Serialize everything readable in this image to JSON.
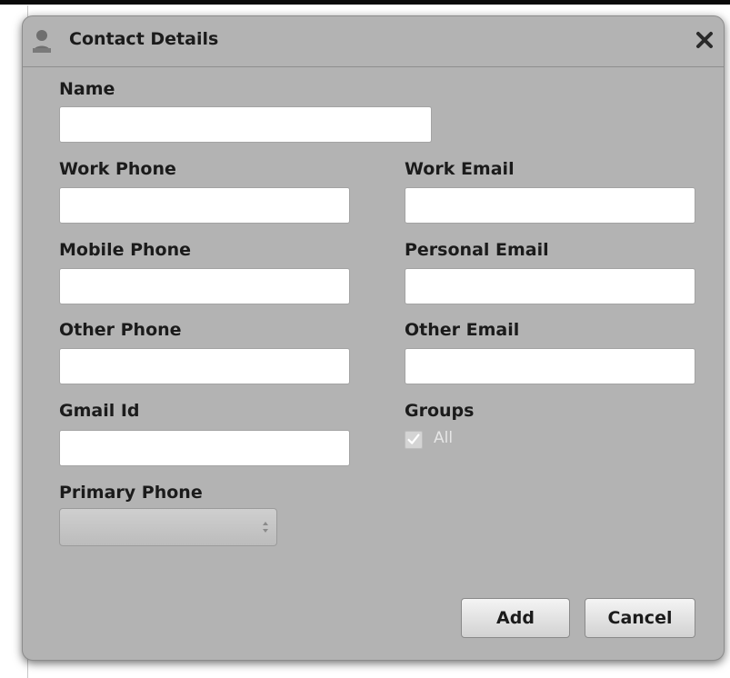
{
  "dialog": {
    "title": "Contact Details",
    "icons": {
      "title_icon": "user-icon",
      "close_icon": "close-icon"
    }
  },
  "form": {
    "name": {
      "label": "Name",
      "value": ""
    },
    "work_phone": {
      "label": "Work Phone",
      "value": ""
    },
    "work_email": {
      "label": "Work Email",
      "value": ""
    },
    "mobile_phone": {
      "label": "Mobile Phone",
      "value": ""
    },
    "personal_email": {
      "label": "Personal Email",
      "value": ""
    },
    "other_phone": {
      "label": "Other Phone",
      "value": ""
    },
    "other_email": {
      "label": "Other Email",
      "value": ""
    },
    "gmail_id": {
      "label": "Gmail Id",
      "value": ""
    },
    "groups": {
      "label": "Groups",
      "checkbox_label": "All",
      "checked": true,
      "disabled": true
    },
    "primary_phone": {
      "label": "Primary Phone",
      "selected": ""
    }
  },
  "buttons": {
    "add_label": "Add",
    "cancel_label": "Cancel"
  },
  "colors": {
    "dialog_bg": "#b3b3b3",
    "field_bg": "#ffffff",
    "title_text": "#1b1b1b",
    "disabled_text": "#e6e6e6"
  }
}
